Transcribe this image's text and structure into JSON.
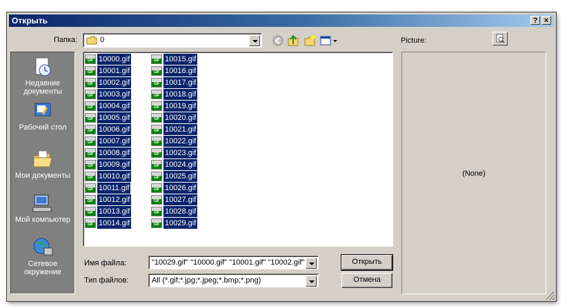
{
  "window": {
    "title": "Открыть",
    "help_label": "?",
    "close_label": "×"
  },
  "toolbar": {
    "folder_label": "Папка:",
    "folder_value": "0"
  },
  "places": [
    {
      "label": "Недавние документы",
      "icon": "recent-documents-icon"
    },
    {
      "label": "Рабочий стол",
      "icon": "desktop-icon"
    },
    {
      "label": "Мои документы",
      "icon": "my-documents-icon"
    },
    {
      "label": "Мой компьютер",
      "icon": "my-computer-icon"
    },
    {
      "label": "Сетевое окружение",
      "icon": "network-icon"
    }
  ],
  "files": {
    "column1": [
      "10000.gif",
      "10001.gif",
      "10002.gif",
      "10003.gif",
      "10004.gif",
      "10005.gif",
      "10006.gif",
      "10007.gif",
      "10008.gif",
      "10009.gif",
      "10010.gif",
      "10011.gif",
      "10012.gif",
      "10013.gif",
      "10014.gif"
    ],
    "column2": [
      "10015.gif",
      "10016.gif",
      "10017.gif",
      "10018.gif",
      "10019.gif",
      "10020.gif",
      "10021.gif",
      "10022.gif",
      "10023.gif",
      "10024.gif",
      "10025.gif",
      "10026.gif",
      "10027.gif",
      "10028.gif",
      "10029.gif"
    ]
  },
  "form": {
    "filename_label": "Имя файла:",
    "filename_value": "\"10029.gif\" \"10000.gif\" \"10001.gif\" \"10002.gif\"",
    "filetype_label": "Тип файлов:",
    "filetype_value": "All (*.gif;*.jpg;*.jpeg;*.bmp;*.png)",
    "open_label": "Открыть",
    "cancel_label": "Отмена"
  },
  "preview": {
    "label": "Picture:",
    "empty_text": "(None)"
  },
  "colors": {
    "selection": "#0a246a",
    "title_start": "#0a246a",
    "face": "#d4d0c8"
  }
}
